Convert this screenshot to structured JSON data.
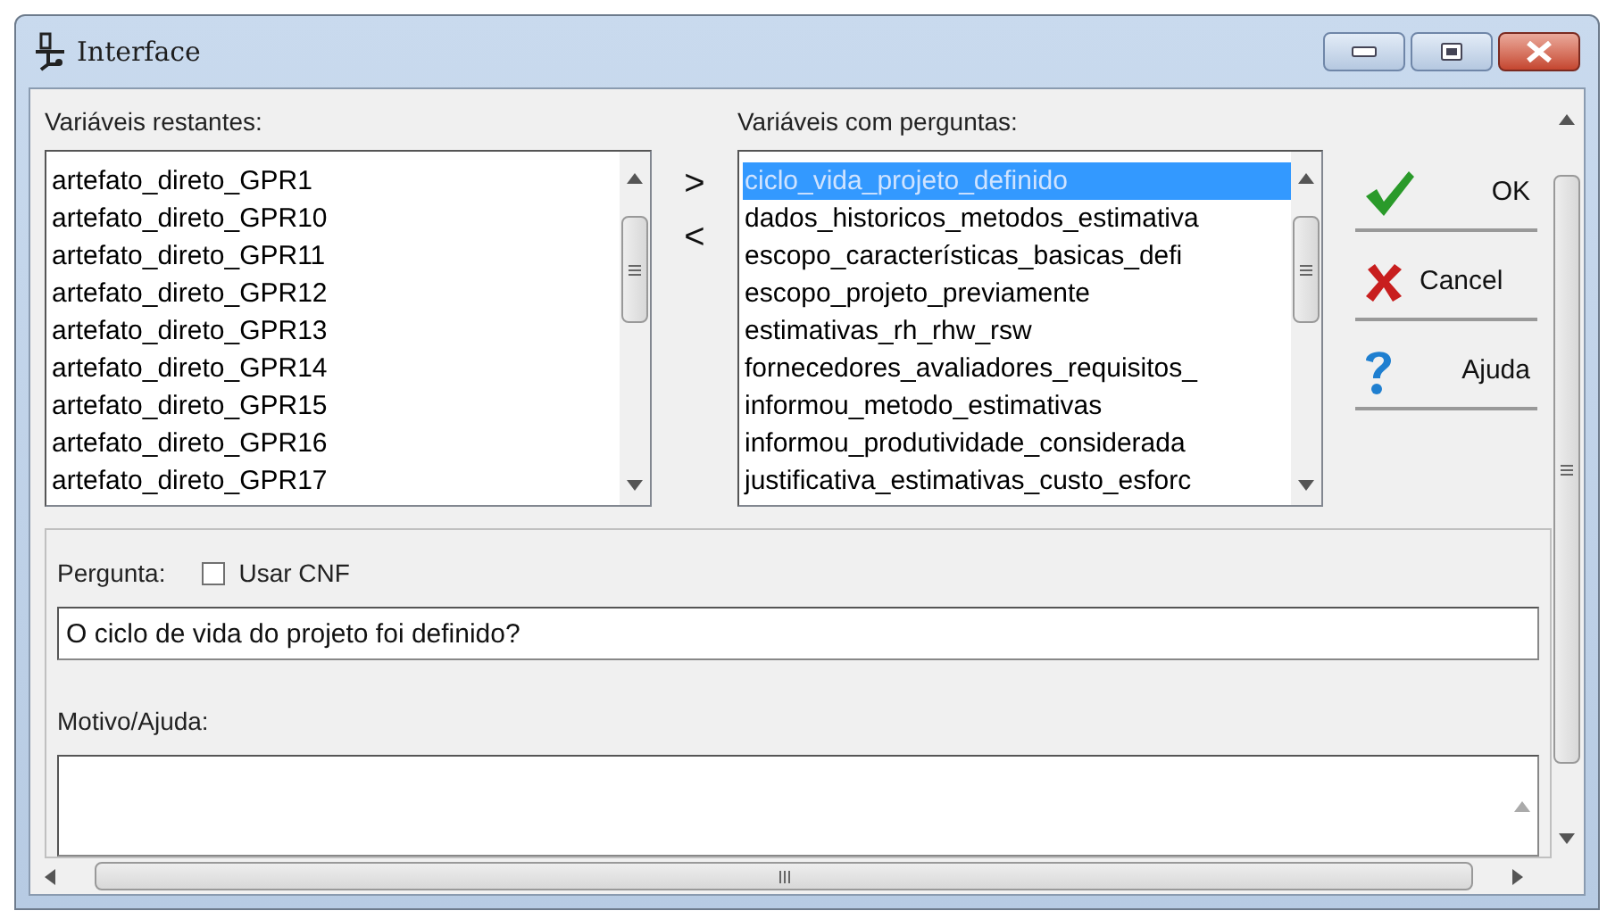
{
  "window": {
    "title": "Interface"
  },
  "left_list": {
    "label": "Variáveis restantes:",
    "items": [
      {
        "text": "artefato_direto_GPR1",
        "selected": false
      },
      {
        "text": "artefato_direto_GPR10",
        "selected": false
      },
      {
        "text": "artefato_direto_GPR11",
        "selected": false
      },
      {
        "text": "artefato_direto_GPR12",
        "selected": false
      },
      {
        "text": "artefato_direto_GPR13",
        "selected": false
      },
      {
        "text": "artefato_direto_GPR14",
        "selected": false
      },
      {
        "text": "artefato_direto_GPR15",
        "selected": false
      },
      {
        "text": "artefato_direto_GPR16",
        "selected": false
      },
      {
        "text": "artefato_direto_GPR17",
        "selected": false
      }
    ]
  },
  "move_buttons": [
    {
      "label": ">"
    },
    {
      "label": "<"
    }
  ],
  "right_list": {
    "label": "Variáveis com perguntas:",
    "items": [
      {
        "text": "ciclo_vida_projeto_definido",
        "selected": true
      },
      {
        "text": "dados_historicos_metodos_estimativa",
        "selected": false
      },
      {
        "text": "escopo_características_basicas_defi",
        "selected": false
      },
      {
        "text": "escopo_projeto_previamente",
        "selected": false
      },
      {
        "text": "estimativas_rh_rhw_rsw",
        "selected": false
      },
      {
        "text": "fornecedores_avaliadores_requisitos_",
        "selected": false
      },
      {
        "text": "informou_metodo_estimativas",
        "selected": false
      },
      {
        "text": "informou_produtividade_considerada",
        "selected": false
      },
      {
        "text": "justificativa_estimativas_custo_esforc",
        "selected": false
      }
    ]
  },
  "buttons": [
    {
      "kind": "ok",
      "label": "OK"
    },
    {
      "kind": "cancel",
      "label": "Cancel"
    },
    {
      "kind": "help",
      "label": "Ajuda"
    }
  ],
  "question": {
    "label": "Pergunta:",
    "checkbox": {
      "label": "Usar CNF",
      "checked": false
    },
    "value": "O ciclo de vida do projeto foi definido?"
  },
  "reason": {
    "label": "Motivo/Ajuda:"
  }
}
